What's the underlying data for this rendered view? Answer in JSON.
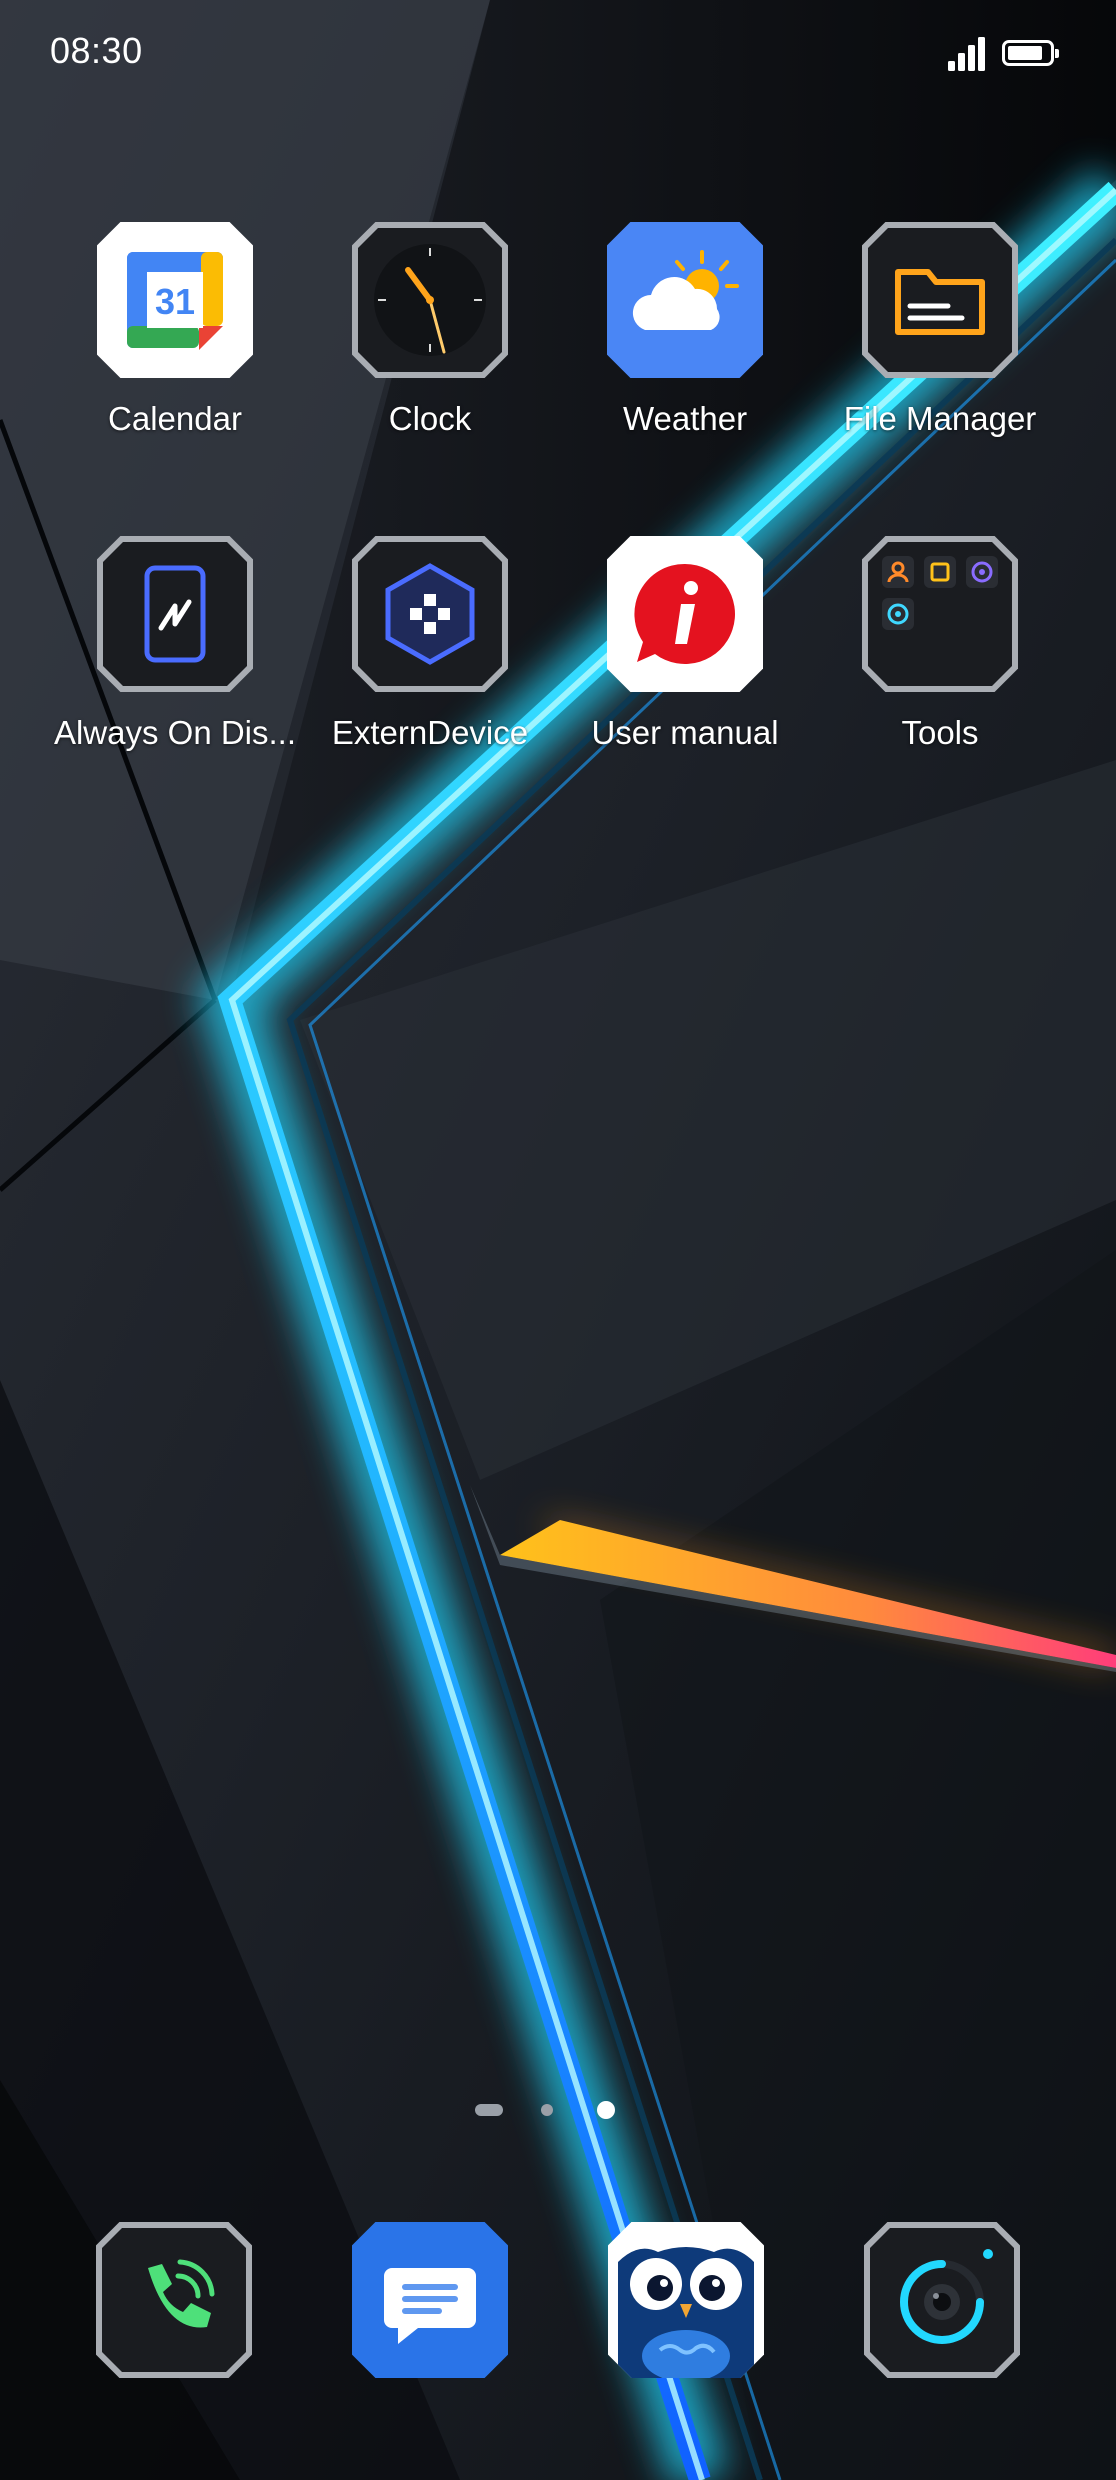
{
  "status_bar": {
    "time": "08:30",
    "signal_icon": "signal-bars-icon",
    "battery_icon": "battery-icon",
    "battery_level_percent": 85
  },
  "apps": [
    {
      "label": "Calendar",
      "icon": "calendar-icon",
      "date": "31"
    },
    {
      "label": "Clock",
      "icon": "clock-icon"
    },
    {
      "label": "Weather",
      "icon": "weather-icon"
    },
    {
      "label": "File Manager",
      "icon": "folder-icon"
    },
    {
      "label": "Always On Dis...",
      "icon": "always-on-display-icon"
    },
    {
      "label": "ExternDevice",
      "icon": "gamepad-icon"
    },
    {
      "label": "User manual",
      "icon": "info-icon"
    },
    {
      "label": "Tools",
      "icon": "tools-folder-icon"
    }
  ],
  "page_indicator": {
    "pages": 3,
    "active_index": 2
  },
  "dock": [
    {
      "name": "phone",
      "icon": "phone-icon"
    },
    {
      "name": "messages",
      "icon": "message-icon"
    },
    {
      "name": "owl-app",
      "icon": "owl-icon"
    },
    {
      "name": "camera",
      "icon": "camera-icon"
    }
  ],
  "colors": {
    "wallpaper_dark": "#15191f",
    "neon_cyan": "#3ff0ff",
    "neon_blue": "#1f74ff",
    "accent_orange": "#ffb020",
    "weather_blue": "#4a86f5",
    "messages_blue": "#2a74e8",
    "manual_red": "#e4121f"
  }
}
